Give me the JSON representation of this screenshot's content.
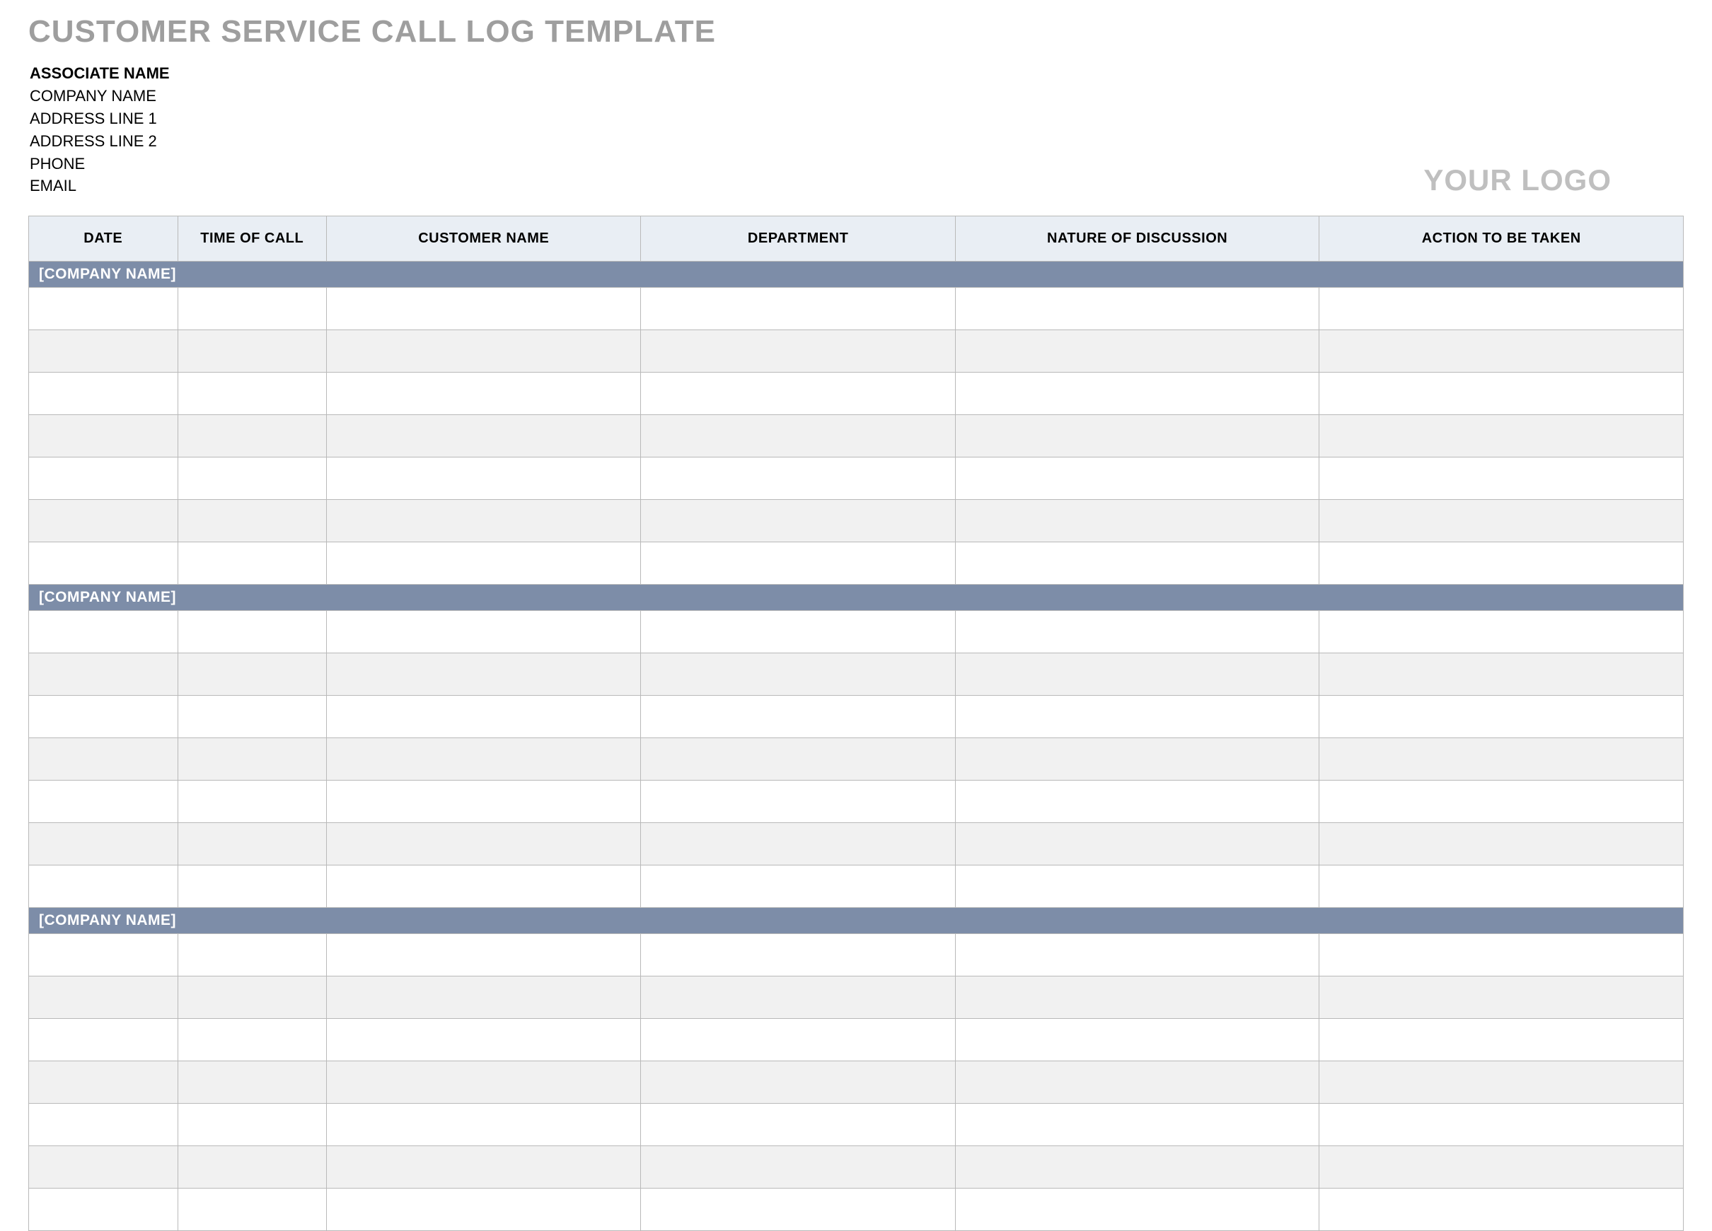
{
  "title": "CUSTOMER SERVICE CALL LOG TEMPLATE",
  "info": {
    "associate_name": "ASSOCIATE NAME",
    "company_name": "COMPANY NAME",
    "address_line_1": "ADDRESS LINE 1",
    "address_line_2": "ADDRESS LINE 2",
    "phone": "PHONE",
    "email": "EMAIL"
  },
  "logo_text": "YOUR LOGO",
  "columns": {
    "date": "DATE",
    "time": "TIME OF CALL",
    "customer_name": "CUSTOMER NAME",
    "department": "DEPARTMENT",
    "nature": "NATURE OF DISCUSSION",
    "action": "ACTION TO BE TAKEN"
  },
  "sections": [
    {
      "label": "[COMPANY NAME]",
      "rows": [
        {
          "date": "",
          "time": "",
          "customer_name": "",
          "department": "",
          "nature": "",
          "action": ""
        },
        {
          "date": "",
          "time": "",
          "customer_name": "",
          "department": "",
          "nature": "",
          "action": ""
        },
        {
          "date": "",
          "time": "",
          "customer_name": "",
          "department": "",
          "nature": "",
          "action": ""
        },
        {
          "date": "",
          "time": "",
          "customer_name": "",
          "department": "",
          "nature": "",
          "action": ""
        },
        {
          "date": "",
          "time": "",
          "customer_name": "",
          "department": "",
          "nature": "",
          "action": ""
        },
        {
          "date": "",
          "time": "",
          "customer_name": "",
          "department": "",
          "nature": "",
          "action": ""
        },
        {
          "date": "",
          "time": "",
          "customer_name": "",
          "department": "",
          "nature": "",
          "action": ""
        }
      ]
    },
    {
      "label": "[COMPANY NAME]",
      "rows": [
        {
          "date": "",
          "time": "",
          "customer_name": "",
          "department": "",
          "nature": "",
          "action": ""
        },
        {
          "date": "",
          "time": "",
          "customer_name": "",
          "department": "",
          "nature": "",
          "action": ""
        },
        {
          "date": "",
          "time": "",
          "customer_name": "",
          "department": "",
          "nature": "",
          "action": ""
        },
        {
          "date": "",
          "time": "",
          "customer_name": "",
          "department": "",
          "nature": "",
          "action": ""
        },
        {
          "date": "",
          "time": "",
          "customer_name": "",
          "department": "",
          "nature": "",
          "action": ""
        },
        {
          "date": "",
          "time": "",
          "customer_name": "",
          "department": "",
          "nature": "",
          "action": ""
        },
        {
          "date": "",
          "time": "",
          "customer_name": "",
          "department": "",
          "nature": "",
          "action": ""
        }
      ]
    },
    {
      "label": "[COMPANY NAME]",
      "rows": [
        {
          "date": "",
          "time": "",
          "customer_name": "",
          "department": "",
          "nature": "",
          "action": ""
        },
        {
          "date": "",
          "time": "",
          "customer_name": "",
          "department": "",
          "nature": "",
          "action": ""
        },
        {
          "date": "",
          "time": "",
          "customer_name": "",
          "department": "",
          "nature": "",
          "action": ""
        },
        {
          "date": "",
          "time": "",
          "customer_name": "",
          "department": "",
          "nature": "",
          "action": ""
        },
        {
          "date": "",
          "time": "",
          "customer_name": "",
          "department": "",
          "nature": "",
          "action": ""
        },
        {
          "date": "",
          "time": "",
          "customer_name": "",
          "department": "",
          "nature": "",
          "action": ""
        },
        {
          "date": "",
          "time": "",
          "customer_name": "",
          "department": "",
          "nature": "",
          "action": ""
        }
      ]
    }
  ]
}
